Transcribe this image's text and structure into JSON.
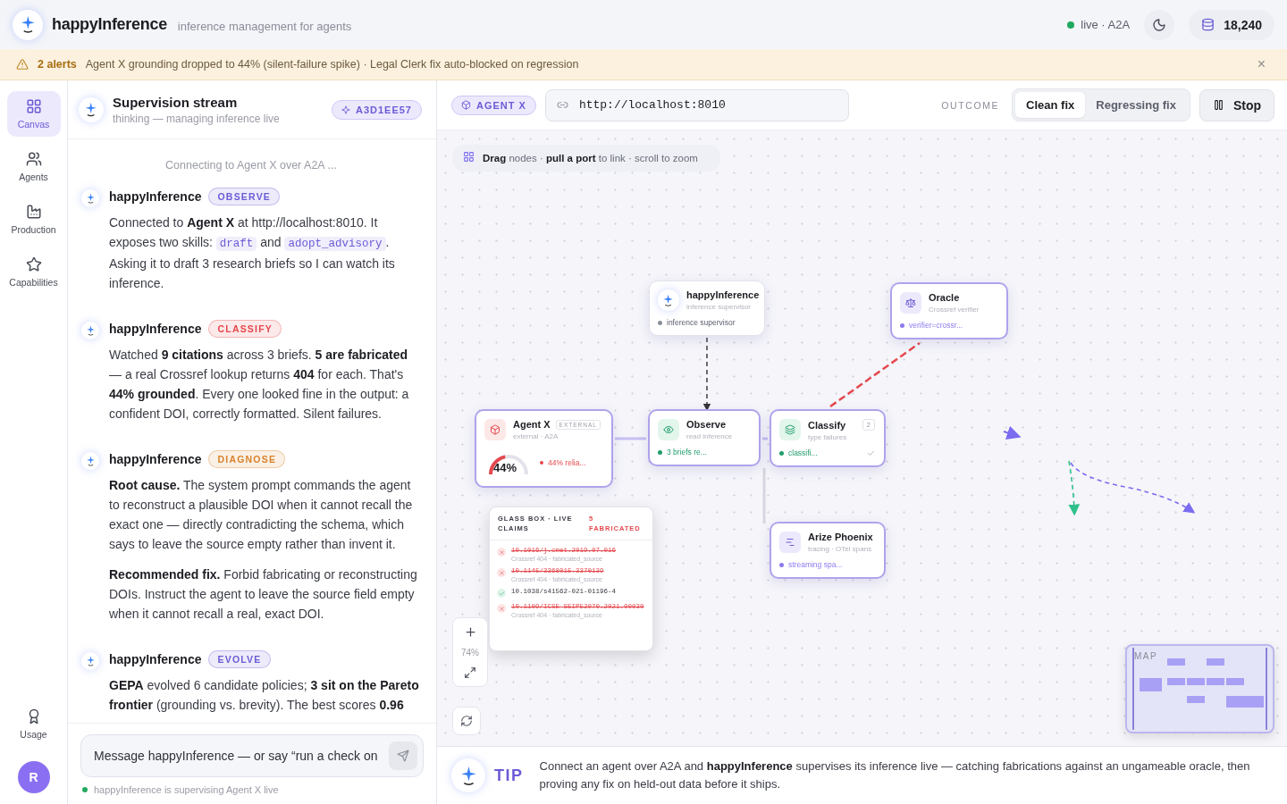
{
  "header": {
    "brand": "happyInference",
    "tagline": "inference management for agents",
    "status": "live · A2A",
    "live": true,
    "credits": "18,240"
  },
  "alert": {
    "count": "2 alerts",
    "message": "Agent X grounding dropped to 44% (silent-failure spike) · Legal Clerk fix auto-blocked on regression",
    "close": "×"
  },
  "nav": {
    "items": [
      {
        "label": "Canvas",
        "kind": "canvas",
        "selected": true
      },
      {
        "label": "Agents",
        "kind": "agents",
        "selected": false
      },
      {
        "label": "Production",
        "kind": "production",
        "selected": false
      },
      {
        "label": "Capabilities",
        "kind": "capabilities",
        "selected": false
      }
    ],
    "bottom": {
      "label": "Usage"
    },
    "avatar": "R"
  },
  "chat": {
    "title": "Supervision stream",
    "subtitle": "thinking — managing inference live",
    "session": "A3D1EE57",
    "system": "Connecting to Agent X over A2A ...",
    "messages": [
      {
        "author": "happyInference",
        "tag": "OBSERVE",
        "color": "#6b5bd6",
        "paragraphs": [
          [
            {
              "kind": "text",
              "text": "Connected to **Agent X** at http://localhost:8010. It exposes two skills: "
            },
            {
              "kind": "code",
              "text": "draft"
            },
            {
              "kind": "text",
              "text": " and "
            },
            {
              "kind": "code",
              "text": "adopt_advisory"
            },
            {
              "kind": "text",
              "text": ". Asking it to draft 3 research briefs so I can watch its inference."
            }
          ]
        ]
      },
      {
        "author": "happyInference",
        "tag": "CLASSIFY",
        "color": "#e5484d",
        "paragraphs": [
          [
            {
              "kind": "text",
              "text": "Watched **9 citations** across 3 briefs. **5 are fabricated** — a real Crossref lookup returns **404** for each. That's **44% grounded**. Every one looked fine in the output: a confident DOI, correctly formatted. Silent failures."
            }
          ]
        ]
      },
      {
        "author": "happyInference",
        "tag": "DIAGNOSE",
        "color": "#d9822b",
        "paragraphs": [
          [
            {
              "kind": "text",
              "text": "**Root cause.** The system prompt commands the agent to reconstruct a plausible DOI when it cannot recall the exact one — directly contradicting the schema, which says to leave the source empty rather than invent it."
            }
          ],
          [
            {
              "kind": "text",
              "text": "**Recommended fix.** Forbid fabricating or reconstructing DOIs. Instruct the agent to leave the source field empty when it cannot recall a real, exact DOI."
            }
          ]
        ]
      },
      {
        "author": "happyInference",
        "tag": "EVOLVE",
        "color": "#6b5bd6",
        "paragraphs": [
          [
            {
              "kind": "text",
              "text": "**GEPA** evolved 6 candidate policies; **3 sit on the Pareto frontier** (grounding vs. brevity). The best scores **0.96**"
            }
          ]
        ]
      }
    ],
    "composer": {
      "placeholder": "Message happyInference — or say “run a check on"
    },
    "footer": "happyInference is supervising Agent X live"
  },
  "toolbar": {
    "agent": "AGENT X",
    "url": "http://localhost:8010",
    "outcome_label": "OUTCOME",
    "outcomes": [
      {
        "label": "Clean fix",
        "selected": true
      },
      {
        "label": "Regressing fix",
        "selected": false
      }
    ],
    "stop": "Stop"
  },
  "canvas": {
    "hint": "**Drag** nodes · **pull a port** to link · scroll to zoom",
    "nodes": [
      {
        "kind": "supervisor",
        "title": "happyInference",
        "subtitle": "inference supervisor",
        "status": "inference supervisor",
        "color": "#8a8f98"
      },
      {
        "kind": "oracle",
        "title": "Oracle",
        "subtitle": "Crossref verifier",
        "status": "verifier=crossr...",
        "color": "#8b7cf0"
      },
      {
        "kind": "agent",
        "title": "Agent X",
        "subtitle": "external · A2A",
        "badge": "EXTERNAL",
        "status": "44% relia...",
        "color": "#e5484d",
        "gauge": {
          "level": 0.44,
          "reading": "44%"
        }
      },
      {
        "kind": "observe",
        "title": "Observe",
        "subtitle": "read inference",
        "status": "3 briefs re...",
        "color": "#1f9d6b"
      },
      {
        "kind": "classify",
        "title": "Classify",
        "subtitle": "type failures",
        "badge": "2",
        "status": "classifi...",
        "color": "#1f9d6b",
        "done": true
      },
      {
        "kind": "tracing",
        "title": "Arize Phoenix",
        "subtitle": "tracing · OTel spans",
        "status": "streaming spa...",
        "color": "#8b7cf0"
      }
    ],
    "glass_box": {
      "title": "GLASS BOX · LIVE CLAIMS",
      "count": "5 FABRICATED",
      "claims": [
        {
          "doi": "10.1016/j.cmet.2019.07.016",
          "note": "Crossref 404 · fabricated_source",
          "verified": false
        },
        {
          "doi": "10.1145/3368015.3370139",
          "note": "Crossref 404 · fabricated_source",
          "verified": false
        },
        {
          "doi": "10.1038/s41562-021-01196-4",
          "verified": true
        },
        {
          "doi": "10.1109/ICSE-SEIP52070.2021.00030",
          "note": "Crossref 404 · fabricated_source",
          "verified": false
        }
      ]
    },
    "zoom": "74%",
    "minimap": "MAP"
  },
  "tip": {
    "label": "TIP",
    "text": "Connect an agent over A2A and **happyInference** supervises its inference live — catching fabrications against an ungameable oracle, then proving any fix on held-out data before it ships."
  }
}
